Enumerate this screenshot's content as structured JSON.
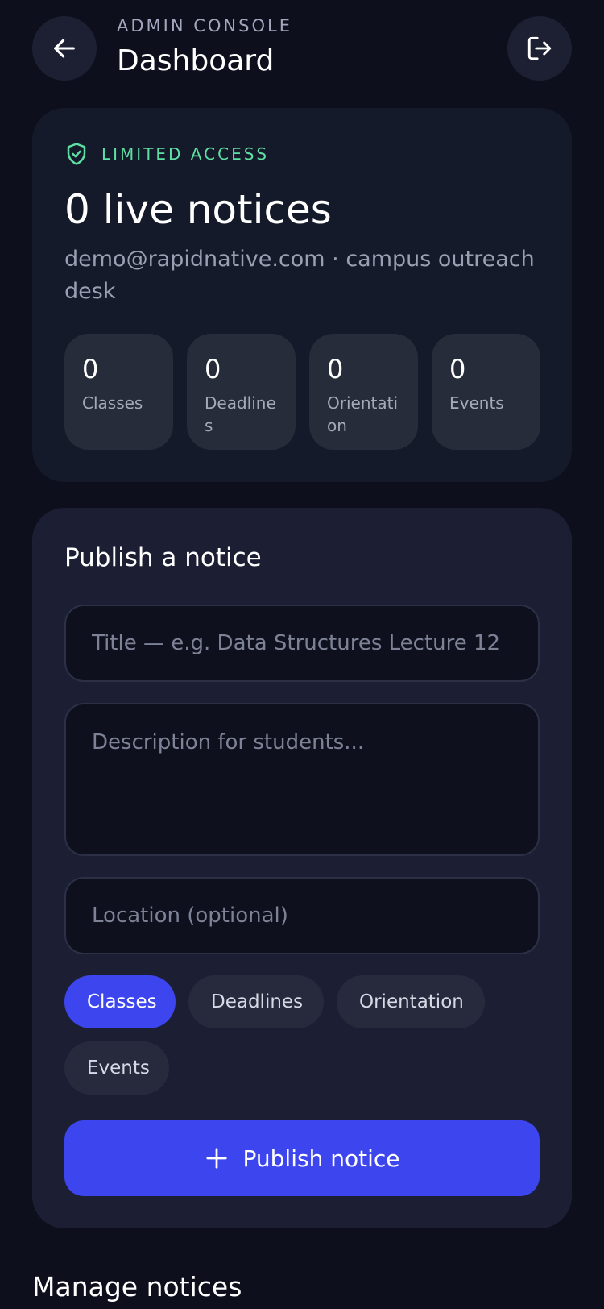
{
  "header": {
    "eyebrow": "ADMIN CONSOLE",
    "title": "Dashboard",
    "back_icon": "arrow-left-icon",
    "logout_icon": "logout-icon"
  },
  "summary": {
    "access_label": "LIMITED ACCESS",
    "access_icon": "shield-check-icon",
    "live_count": "0 live notices",
    "account_line": "demo@rapidnative.com · campus outreach desk",
    "stats": [
      {
        "value": "0",
        "label": "Classes"
      },
      {
        "value": "0",
        "label": "Deadlines"
      },
      {
        "value": "0",
        "label": "Orientation"
      },
      {
        "value": "0",
        "label": "Events"
      }
    ]
  },
  "publish": {
    "title": "Publish a notice",
    "title_placeholder": "Title — e.g. Data Structures Lecture 12",
    "title_value": "",
    "description_placeholder": "Description for students...",
    "description_value": "",
    "location_placeholder": "Location (optional)",
    "location_value": "",
    "categories": [
      "Classes",
      "Deadlines",
      "Orientation",
      "Events"
    ],
    "selected_category": "Classes",
    "button_label": "Publish notice",
    "button_icon": "plus-icon"
  },
  "manage": {
    "title": "Manage notices"
  },
  "colors": {
    "background": "#0d0f1c",
    "accent": "#3d46ee",
    "access_green": "#5ee0a5"
  }
}
